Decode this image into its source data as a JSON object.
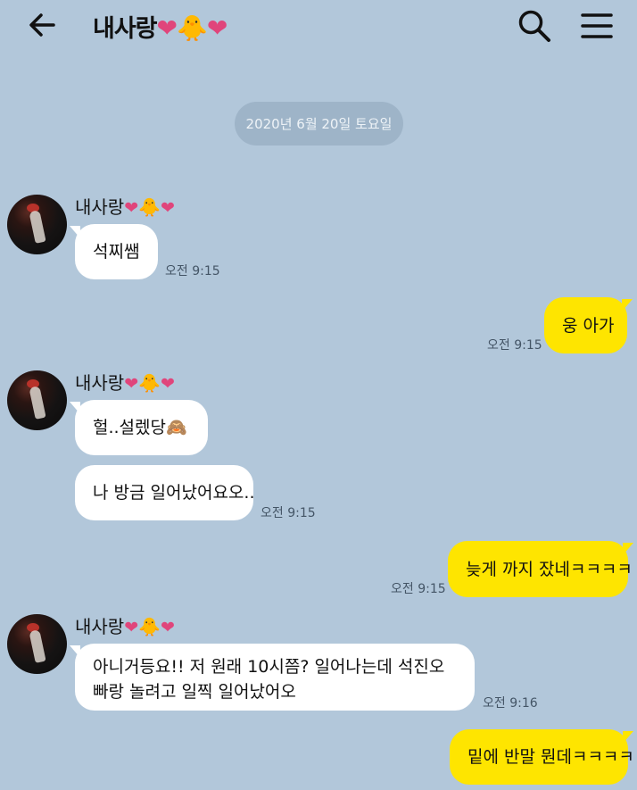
{
  "header": {
    "title": "내사랑",
    "title_emojis": [
      "❤",
      "🐥",
      "❤"
    ],
    "back_icon": "arrow-left-icon",
    "search_icon": "search-icon",
    "menu_icon": "hamburger-menu-icon"
  },
  "date_divider": "2020년 6월 20일 토요일",
  "sender": {
    "name": "내사랑",
    "emojis": [
      "❤",
      "🐥",
      "❤"
    ]
  },
  "messages": [
    {
      "from": "them",
      "text": "석찌쌤",
      "time": "오전 9:15"
    },
    {
      "from": "me",
      "text": "웅 아가",
      "time": "오전 9:15"
    },
    {
      "from": "them",
      "text": "헐..설렜당🙈",
      "time": ""
    },
    {
      "from": "them",
      "text": "나 방금 일어났어요오..",
      "time": "오전 9:15"
    },
    {
      "from": "me",
      "text": "늦게 까지 잤네ㅋㅋㅋㅋ",
      "time": "오전 9:15"
    },
    {
      "from": "them",
      "text": "아니거등요!! 저 원래 10시쯤? 일어나는데 석진오빠랑 놀려고 일찍 일어났어오",
      "time": "오전 9:16"
    },
    {
      "from": "me",
      "text": "밑에 반말 뭔데ㅋㅋㅋㅋ",
      "time": ""
    }
  ],
  "colors": {
    "background": "#b2c7da",
    "my_bubble": "#fee500",
    "their_bubble": "#ffffff",
    "heart": "#e0457b"
  }
}
